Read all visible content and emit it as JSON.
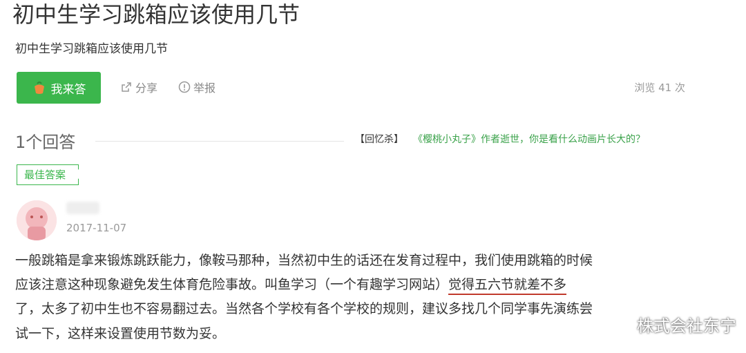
{
  "question": {
    "title": "初中生学习跳箱应该使用几节",
    "subtitle": "初中生学习跳箱应该使用几节"
  },
  "actions": {
    "answer_label": "我来答",
    "share_label": "分享",
    "report_label": "举报",
    "views_text": "浏览 41 次"
  },
  "answers_header": {
    "count_text": "1个回答",
    "promo_tag": "【回忆杀】",
    "promo_text": "《樱桃小丸子》作者逝世，你是看什么动画片长大的？"
  },
  "best_answer": {
    "badge": "最佳答案",
    "date": "2017-11-07",
    "lines": {
      "l1": "一般跳箱是拿来锻炼跳跃能力，像鞍马那种，当然初中生的话还在发育过程中，我们使用跳箱的时候",
      "l2_a": "应该注意这种现象避免发生体育危险事故。叫鱼学习（一个有趣学习网站）",
      "l2_b": "觉得五六节就差不多",
      "l3": "了，太多了初中生也不容易翻过去。当然各个学校有各个学校的规则，建议多找几个同学事先演练尝",
      "l4": "试一下，这样来设置使用节数为妥。"
    }
  },
  "watermark": {
    "text": "株式会社东宁",
    "icon": "wechat-icon"
  },
  "colors": {
    "accent": "#3bb64c",
    "underline": "#c0392b"
  }
}
